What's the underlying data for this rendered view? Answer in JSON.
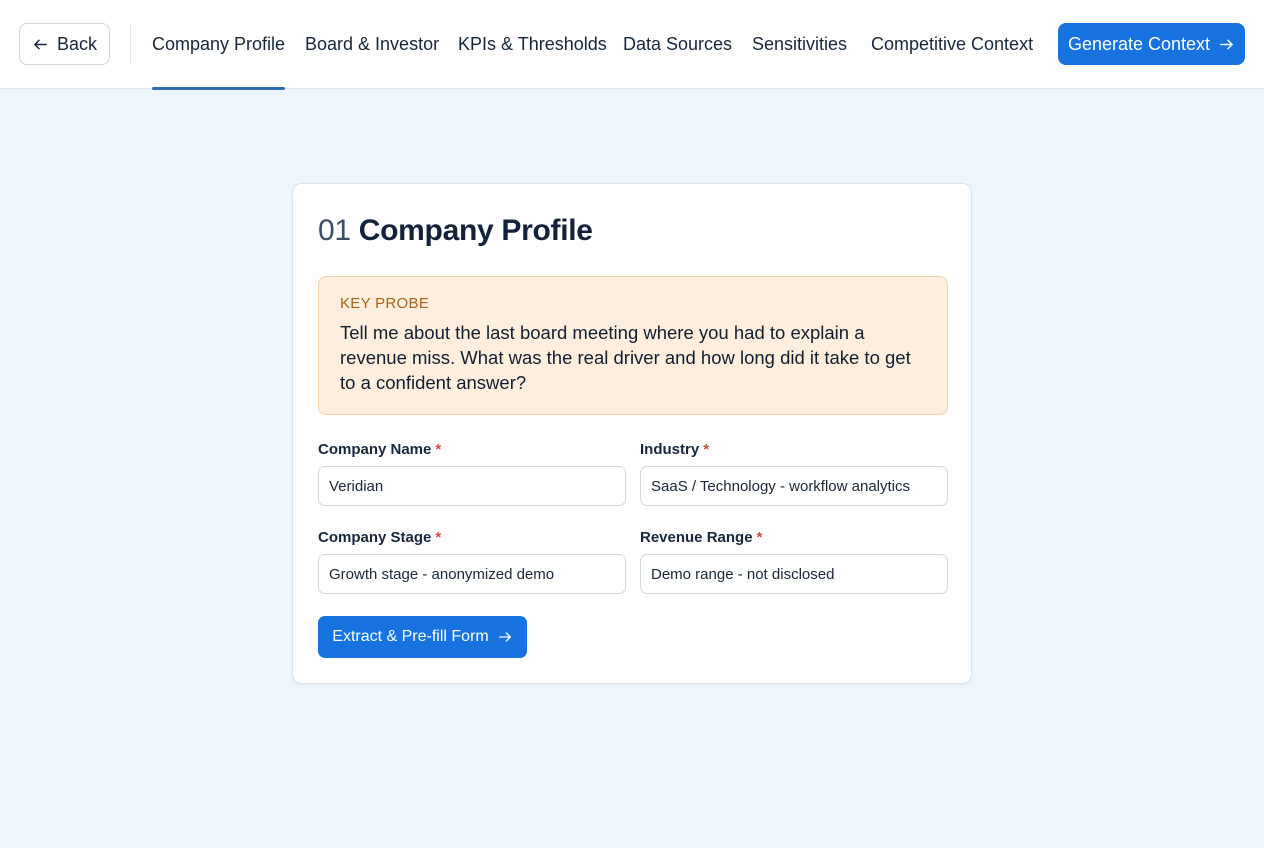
{
  "header": {
    "back_label": "Back",
    "tabs": [
      {
        "label": "Company Profile",
        "active": true
      },
      {
        "label": "Board & Investor",
        "active": false
      },
      {
        "label": "KPIs & Thresholds",
        "active": false
      },
      {
        "label": "Data Sources",
        "active": false
      },
      {
        "label": "Sensitivities",
        "active": false
      },
      {
        "label": "Competitive Context",
        "active": false
      }
    ],
    "generate_label": "Generate Context"
  },
  "section": {
    "number": "01",
    "title": "Company Profile"
  },
  "probe": {
    "label": "KEY PROBE",
    "text": "Tell me about the last board meeting where you had to explain a revenue miss. What was the real driver and how long did it take to get to a confident answer?"
  },
  "form": {
    "required_mark": "*",
    "company_name": {
      "label": "Company Name",
      "value": "Veridian"
    },
    "industry": {
      "label": "Industry",
      "value": "SaaS / Technology - workflow analytics"
    },
    "company_stage": {
      "label": "Company Stage",
      "value": "Growth stage - anonymized demo"
    },
    "revenue_range": {
      "label": "Revenue Range",
      "value": "Demo range - not disclosed"
    },
    "extract_label": "Extract & Pre-fill Form"
  },
  "colors": {
    "accent": "#1673e0",
    "active_tab_underline": "#2f6fb0",
    "probe_background": "#fdeedd",
    "probe_label": "#a5641a",
    "required": "#d24a3a",
    "page_background": "#eef6fd"
  },
  "icons": {
    "back": "arrow-left-icon",
    "generate": "arrow-right-icon",
    "extract": "arrow-right-icon"
  }
}
